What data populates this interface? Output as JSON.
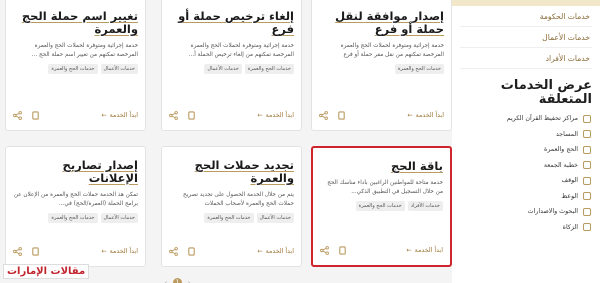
{
  "sidebar": {
    "nav": [
      "خدمات الحكومة",
      "خدمات الأعمال",
      "خدمات الأفراد"
    ],
    "filter_title": "عرض الخدمات المتعلقة",
    "filters": [
      "مراكز تحفيظ القرآن الكريم",
      "المساجد",
      "الحج والعمرة",
      "خطبة الجمعة",
      "الوقف",
      "الوعظ",
      "البحوث والاصدارات",
      "الزكاة"
    ]
  },
  "cards": [
    {
      "title": "إصدار موافقة لنقل حملة أو فرع",
      "desc": "خدمة إجرائية ومتوفرة لحملات الحج والعمرة المرخصة تمكنهم من نقل مقر حملة أو فرع",
      "tags": [
        "خدمات الأعمال",
        "خدمات الحج والعمرة"
      ],
      "start": "ابدأ الخدمة",
      "highlight": false
    },
    {
      "title": "إلغاء ترخيص حملة أو فرع",
      "desc": "خدمة إجرائية ومتوفرة لحملات الحج والعمرة المرخصة تمكنهم من إلغاء ترخيص الحملة أ...",
      "tags": [
        "خدمات الأعمال",
        "خدمات الحج والعمرة"
      ],
      "start": "ابدأ الخدمة",
      "highlight": false
    },
    {
      "title": "تغيير اسم حملة الحج والعمرة",
      "desc": "خدمة إجرائية ومتوفرة لحملات الحج والعمرة المرخصة تمكنهم من تغيير اسم حملة الحج ...",
      "tags": [
        "خدمات الأعمال",
        "خدمات الحج والعمرة"
      ],
      "start": "ابدأ الخدمة",
      "highlight": false
    },
    {
      "title": "باقة الحج",
      "desc": "خدمة متاحة للمواطنين الراغبين بأداء مناسك الحج من خلال التسجيل في التطبيق الذكي...",
      "tags": [
        "خدمات الأفراد",
        "خدمات الحج والعمرة"
      ],
      "start": "ابدأ الخدمة",
      "highlight": true
    },
    {
      "title": "تجديد حملات الحج والعمرة",
      "desc": "يتم من خلال الخدمة الحصول على تجديد تصريح حملات الحج والعمرة لأصحاب الحملات",
      "tags": [
        "خدمات الأعمال",
        "خدمات الحج والعمرة"
      ],
      "start": "ابدأ الخدمة",
      "highlight": false
    },
    {
      "title": "إصدار تصاريح الإعلانات",
      "desc": "تمكن هذ الخدمة حملات الحج والعمرة من الإعلان عن برامج الحملة (العمرة/الحج) في...",
      "tags": [
        "خدمات الأعمال",
        "خدمات الحج والعمرة"
      ],
      "start": "ابدأ الخدمة",
      "highlight": false
    }
  ],
  "pager": {
    "current": "1"
  },
  "watermark": "مقالات الإمارات",
  "colors": {
    "accent": "#b99a5f",
    "highlight": "#d0242c"
  }
}
